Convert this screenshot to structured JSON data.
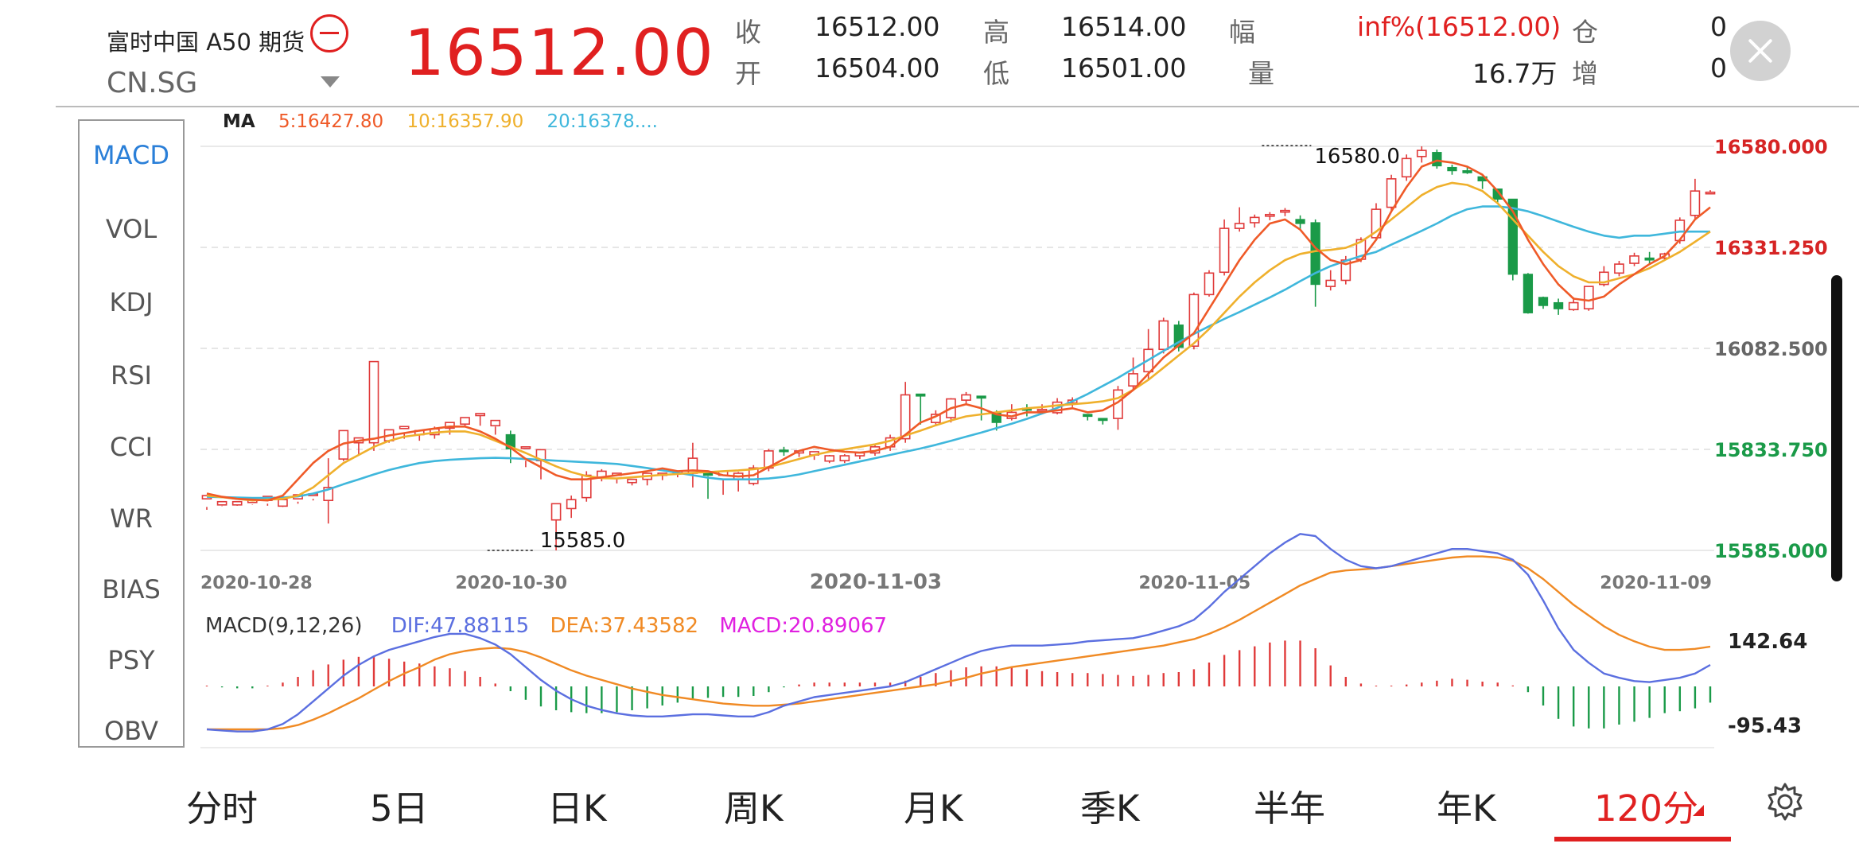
{
  "header": {
    "title": "富时中国 A50 期货",
    "symbol": "CN.SG",
    "price": "16512.00",
    "quote": {
      "close_label": "收",
      "close_value": "16512.00",
      "high_label": "高",
      "high_value": "16514.00",
      "change_label": "幅",
      "change_value": "inf%(16512.00)",
      "position_label": "仓",
      "position_value": "0",
      "open_label": "开",
      "open_value": "16504.00",
      "low_label": "低",
      "low_value": "16501.00",
      "volume_label": "量",
      "volume_value": "16.7万",
      "increase_label": "增",
      "increase_value": "0"
    },
    "icons": {
      "collapse": "minus-circle-icon",
      "dropdown": "caret-down-icon",
      "close": "close-icon"
    }
  },
  "indicators": {
    "active": "MACD",
    "items": [
      "MACD",
      "VOL",
      "KDJ",
      "RSI",
      "CCI",
      "WR",
      "BIAS",
      "PSY",
      "OBV"
    ]
  },
  "tabs": {
    "items": [
      "分时",
      "5日",
      "日K",
      "周K",
      "月K",
      "季K",
      "半年",
      "年K",
      "120分"
    ],
    "active": "120分",
    "settings_icon": "gear-icon"
  },
  "colors": {
    "up": "#e03a3a",
    "down": "#1a9a48",
    "ma5": "#ef5a28",
    "ma10": "#efb02c",
    "ma20": "#3fb7dc",
    "dif": "#5b6fe0",
    "dea": "#f08a24",
    "macd": "#e020e0",
    "accent": "#e02020"
  },
  "chart_data": [
    {
      "type": "candlestick",
      "ma_label": "MA",
      "ma_legend": [
        {
          "name": "5",
          "text": "5:16427.80"
        },
        {
          "name": "10",
          "text": "10:16357.90"
        },
        {
          "name": "20",
          "text": "20:16378...."
        }
      ],
      "y_ticks": [
        "16580.000",
        "16331.250",
        "16082.500",
        "15833.750",
        "15585.000"
      ],
      "ylim": [
        15585,
        16580
      ],
      "x_tick_labels": [
        "2020-10-28",
        "2020-10-30",
        "2020-11-03",
        "2020-11-05",
        "2020-11-09"
      ],
      "x_tick_indices": [
        0,
        19,
        43,
        64,
        82
      ],
      "annotations": {
        "max": "16580.0",
        "min": "15585.0"
      },
      "max_index": 70,
      "min_index": 19,
      "ohlc": [
        [
          15712,
          15720,
          15692,
          15685
        ],
        [
          15697,
          15705,
          15695,
          15694
        ],
        [
          15697,
          15705,
          15700,
          15695
        ],
        [
          15703,
          15708,
          15697,
          15698
        ],
        [
          15708,
          15718,
          15700,
          15695
        ],
        [
          15694,
          15710,
          15703,
          15692
        ],
        [
          15712,
          15722,
          15705,
          15700
        ],
        [
          15720,
          15724,
          15712,
          15708
        ],
        [
          15708,
          15740,
          15812,
          15651
        ],
        [
          15810,
          15880,
          15845,
          15805
        ],
        [
          15850,
          15862,
          15855,
          15820
        ],
        [
          15850,
          16050,
          15855,
          15830
        ],
        [
          15855,
          15882,
          15865,
          15850
        ],
        [
          15885,
          15890,
          15875,
          15860
        ],
        [
          15870,
          15880,
          15875,
          15855
        ],
        [
          15870,
          15884,
          15890,
          15860
        ],
        [
          15886,
          15900,
          15895,
          15870
        ],
        [
          15896,
          15912,
          15900,
          15888
        ],
        [
          15917,
          15922,
          15917,
          15892
        ],
        [
          15892,
          15905,
          15890,
          15870
        ],
        [
          15870,
          15835,
          15880,
          15800
        ],
        [
          15836,
          15840,
          15806,
          15790
        ],
        [
          15806,
          15833,
          15810,
          15760
        ],
        [
          15660,
          15700,
          15660,
          15585
        ],
        [
          15688,
          15710,
          15720,
          15665
        ],
        [
          15715,
          15770,
          15780,
          15705
        ],
        [
          15765,
          15780,
          15785,
          15755
        ],
        [
          15770,
          15775,
          15760,
          15750
        ],
        [
          15752,
          15760,
          15760,
          15745
        ],
        [
          15760,
          15775,
          15770,
          15745
        ],
        [
          15770,
          15775,
          15770,
          15758
        ],
        [
          15775,
          15780,
          15782,
          15765
        ],
        [
          15775,
          15812,
          15850,
          15740
        ],
        [
          15778,
          15770,
          15768,
          15712
        ],
        [
          15770,
          15780,
          15760,
          15722
        ],
        [
          15760,
          15775,
          15778,
          15730
        ],
        [
          15750,
          15788,
          15795,
          15745
        ],
        [
          15788,
          15830,
          15835,
          15780
        ],
        [
          15832,
          15830,
          15840,
          15818
        ],
        [
          15825,
          15830,
          15828,
          15815
        ],
        [
          15820,
          15828,
          15826,
          15808
        ],
        [
          15805,
          15818,
          15820,
          15800
        ],
        [
          15806,
          15818,
          15822,
          15800
        ],
        [
          15818,
          15825,
          15828,
          15810
        ],
        [
          15825,
          15840,
          15845,
          15818
        ],
        [
          15840,
          15862,
          15870,
          15830
        ],
        [
          15860,
          15968,
          16000,
          15850
        ],
        [
          15970,
          15965,
          15970,
          15895
        ],
        [
          15900,
          15920,
          15930,
          15895
        ],
        [
          15912,
          15958,
          15960,
          15900
        ],
        [
          15955,
          15968,
          15975,
          15945
        ],
        [
          15965,
          15960,
          15965,
          15905
        ],
        [
          15925,
          15900,
          15930,
          15880
        ],
        [
          15910,
          15925,
          15945,
          15905
        ],
        [
          15935,
          15930,
          15945,
          15915
        ],
        [
          15928,
          15932,
          15945,
          15920
        ],
        [
          15924,
          15950,
          15960,
          15920
        ],
        [
          15948,
          15955,
          15962,
          15938
        ],
        [
          15920,
          15915,
          15920,
          15905
        ],
        [
          15910,
          15905,
          15910,
          15895
        ],
        [
          15910,
          15980,
          15990,
          15882
        ],
        [
          15990,
          16020,
          16060,
          15982
        ],
        [
          16025,
          16080,
          16130,
          16005
        ],
        [
          16080,
          16150,
          16158,
          16070
        ],
        [
          16140,
          16085,
          16150,
          16075
        ],
        [
          16088,
          16215,
          16220,
          16080
        ],
        [
          16215,
          16268,
          16275,
          16210
        ],
        [
          16270,
          16378,
          16400,
          16262
        ],
        [
          16378,
          16390,
          16430,
          16370
        ],
        [
          16392,
          16405,
          16412,
          16380
        ],
        [
          16408,
          16412,
          16418,
          16398
        ],
        [
          16420,
          16422,
          16428,
          16408
        ],
        [
          16400,
          16390,
          16410,
          16376
        ],
        [
          16392,
          16240,
          16400,
          16185
        ],
        [
          16235,
          16250,
          16275,
          16225
        ],
        [
          16250,
          16300,
          16310,
          16240
        ],
        [
          16302,
          16350,
          16356,
          16295
        ],
        [
          16355,
          16425,
          16440,
          16348
        ],
        [
          16430,
          16500,
          16510,
          16420
        ],
        [
          16505,
          16550,
          16560,
          16495
        ],
        [
          16555,
          16570,
          16580,
          16540
        ],
        [
          16565,
          16532,
          16572,
          16525
        ],
        [
          16528,
          16520,
          16535,
          16510
        ],
        [
          16520,
          16515,
          16528,
          16512
        ],
        [
          16505,
          16495,
          16500,
          16475
        ],
        [
          16475,
          16450,
          16458,
          16440
        ],
        [
          16450,
          16265,
          16450,
          16250
        ],
        [
          16265,
          16170,
          16268,
          16168
        ],
        [
          16208,
          16188,
          16210,
          16180
        ],
        [
          16195,
          16180,
          16205,
          16165
        ],
        [
          16178,
          16195,
          16208,
          16175
        ],
        [
          16180,
          16235,
          16210,
          16175
        ],
        [
          16240,
          16270,
          16285,
          16235
        ],
        [
          16268,
          16290,
          16298,
          16260
        ],
        [
          16292,
          16310,
          16318,
          16285
        ],
        [
          16305,
          16300,
          16320,
          16290
        ],
        [
          16305,
          16315,
          16318,
          16298
        ],
        [
          16348,
          16398,
          16405,
          16340
        ],
        [
          16410,
          16470,
          16500,
          16400
        ],
        [
          16465,
          16467,
          16472,
          16462
        ]
      ],
      "ma5": [
        15725,
        15717,
        15712,
        15710,
        15708,
        15720,
        15760,
        15800,
        15830,
        15848,
        15855,
        15860,
        15868,
        15874,
        15880,
        15885,
        15890,
        15890,
        15878,
        15860,
        15838,
        15810,
        15790,
        15770,
        15760,
        15760,
        15765,
        15770,
        15775,
        15780,
        15787,
        15780,
        15782,
        15780,
        15770,
        15767,
        15770,
        15790,
        15810,
        15830,
        15840,
        15833,
        15828,
        15826,
        15830,
        15840,
        15870,
        15900,
        15915,
        15935,
        15945,
        15935,
        15920,
        15915,
        15925,
        15925,
        15930,
        15935,
        15925,
        15930,
        15950,
        15980,
        16020,
        16060,
        16090,
        16120,
        16180,
        16240,
        16300,
        16350,
        16390,
        16400,
        16375,
        16330,
        16300,
        16290,
        16300,
        16350,
        16420,
        16480,
        16530,
        16545,
        16540,
        16530,
        16510,
        16470,
        16420,
        16350,
        16290,
        16240,
        16205,
        16200,
        16210,
        16240,
        16265,
        16290,
        16310,
        16350,
        16400,
        16430
      ],
      "ma10": [
        15720,
        15716,
        15712,
        15708,
        15710,
        15712,
        15720,
        15740,
        15770,
        15800,
        15820,
        15840,
        15855,
        15865,
        15870,
        15875,
        15878,
        15878,
        15870,
        15855,
        15840,
        15825,
        15808,
        15792,
        15778,
        15768,
        15763,
        15762,
        15765,
        15768,
        15771,
        15773,
        15776,
        15778,
        15780,
        15782,
        15785,
        15790,
        15800,
        15810,
        15820,
        15828,
        15834,
        15840,
        15846,
        15855,
        15868,
        15880,
        15893,
        15905,
        15915,
        15920,
        15925,
        15930,
        15935,
        15938,
        15942,
        15945,
        15948,
        15952,
        15960,
        15980,
        16005,
        16035,
        16065,
        16095,
        16130,
        16170,
        16210,
        16245,
        16275,
        16300,
        16315,
        16322,
        16325,
        16330,
        16345,
        16370,
        16400,
        16430,
        16460,
        16480,
        16490,
        16485,
        16470,
        16440,
        16400,
        16360,
        16320,
        16285,
        16260,
        16245,
        16245,
        16255,
        16265,
        16280,
        16300,
        16320,
        16345,
        16370
      ],
      "ma20": [
        15717,
        15716,
        15715,
        15714,
        15714,
        15715,
        15718,
        15725,
        15735,
        15748,
        15760,
        15772,
        15783,
        15792,
        15800,
        15805,
        15808,
        15810,
        15812,
        15813,
        15812,
        15810,
        15808,
        15806,
        15804,
        15802,
        15800,
        15798,
        15793,
        15788,
        15782,
        15776,
        15770,
        15764,
        15760,
        15760,
        15760,
        15762,
        15766,
        15772,
        15780,
        15788,
        15796,
        15804,
        15812,
        15820,
        15828,
        15836,
        15845,
        15855,
        15865,
        15875,
        15886,
        15897,
        15909,
        15922,
        15936,
        15952,
        15970,
        15990,
        16010,
        16032,
        16054,
        16076,
        16098,
        16118,
        16137,
        16155,
        16172,
        16190,
        16208,
        16227,
        16248,
        16268,
        16285,
        16298,
        16310,
        16320,
        16338,
        16355,
        16372,
        16390,
        16410,
        16425,
        16432,
        16432,
        16428,
        16420,
        16408,
        16395,
        16382,
        16370,
        16360,
        16355,
        16360,
        16360,
        16365,
        16370,
        16370,
        16370
      ]
    },
    {
      "type": "macd",
      "label": "MACD(9,12,26)",
      "legend": {
        "dif": "DIF:47.88115",
        "dea": "DEA:37.43582",
        "macd": "MACD:20.89067"
      },
      "y_ticks": [
        "142.64",
        "-95.43"
      ],
      "ylim": [
        -95.43,
        142.64
      ],
      "dif": [
        -40,
        -41,
        -42,
        -42,
        -40,
        -35,
        -26,
        -14,
        -2,
        10,
        20,
        28,
        34,
        38,
        42,
        46,
        49,
        49,
        45,
        39,
        30,
        18,
        6,
        -4,
        -12,
        -18,
        -22,
        -25,
        -27,
        -28,
        -28,
        -27,
        -26,
        -26,
        -27,
        -28,
        -28,
        -24,
        -18,
        -14,
        -10,
        -8,
        -6,
        -4,
        -2,
        0,
        4,
        10,
        16,
        22,
        28,
        33,
        36,
        38,
        38,
        38,
        39,
        40,
        42,
        43,
        44,
        45,
        48,
        52,
        56,
        62,
        74,
        88,
        100,
        112,
        124,
        134,
        142,
        140,
        128,
        118,
        112,
        110,
        112,
        116,
        120,
        124,
        128,
        128,
        126,
        124,
        118,
        104,
        80,
        54,
        34,
        22,
        12,
        8,
        5,
        4,
        6,
        8,
        12,
        20
      ],
      "dea": [
        -40,
        -40,
        -40,
        -40,
        -40,
        -39,
        -36,
        -31,
        -25,
        -18,
        -11,
        -3,
        5,
        12,
        18,
        25,
        30,
        33,
        35,
        36,
        35,
        32,
        27,
        21,
        15,
        10,
        6,
        2,
        -2,
        -5,
        -8,
        -10,
        -12,
        -14,
        -16,
        -17,
        -18,
        -18,
        -17,
        -16,
        -14,
        -12,
        -10,
        -8,
        -6,
        -4,
        -2,
        0,
        2,
        5,
        8,
        12,
        15,
        18,
        20,
        22,
        24,
        26,
        28,
        30,
        32,
        34,
        36,
        38,
        41,
        44,
        49,
        55,
        62,
        70,
        78,
        86,
        94,
        100,
        106,
        108,
        109,
        110,
        112,
        114,
        116,
        118,
        120,
        121,
        121,
        120,
        117,
        110,
        100,
        88,
        76,
        66,
        56,
        48,
        42,
        37,
        34,
        34,
        35,
        37
      ],
      "macd": [
        0,
        -1,
        -2,
        -2,
        0,
        4,
        10,
        17,
        23,
        28,
        31,
        31,
        29,
        26,
        24,
        21,
        19,
        16,
        10,
        3,
        -5,
        -14,
        -21,
        -25,
        -27,
        -28,
        -28,
        -27,
        -25,
        -23,
        -20,
        -17,
        -14,
        -12,
        -11,
        -11,
        -10,
        -6,
        -1,
        2,
        4,
        4,
        4,
        4,
        4,
        4,
        6,
        10,
        14,
        17,
        20,
        21,
        21,
        20,
        18,
        16,
        15,
        14,
        14,
        13,
        12,
        11,
        12,
        14,
        15,
        18,
        25,
        33,
        38,
        42,
        46,
        48,
        48,
        40,
        22,
        10,
        3,
        0,
        0,
        2,
        4,
        6,
        8,
        7,
        5,
        4,
        1,
        -6,
        -20,
        -34,
        -42,
        -44,
        -44,
        -40,
        -37,
        -33,
        -28,
        -26,
        -23,
        -17
      ]
    }
  ]
}
